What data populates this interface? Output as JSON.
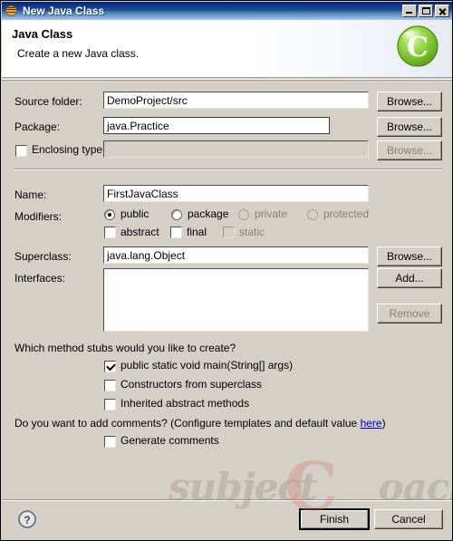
{
  "window": {
    "title": "New Java Class",
    "icon": "java-wizard-icon",
    "controls": {
      "minimize": "Minimize",
      "maximize": "Maximize",
      "close": "Close"
    }
  },
  "header": {
    "title": "Java Class",
    "subtitle": "Create a new Java class.",
    "icon": "green-c-class-icon"
  },
  "form": {
    "source_folder": {
      "label": "Source folder:",
      "value": "DemoProject/src",
      "browse": "Browse..."
    },
    "package": {
      "label": "Package:",
      "value": "java.Practice",
      "browse": "Browse..."
    },
    "enclosing_type": {
      "label": "Enclosing type:",
      "value": "",
      "checked": false,
      "browse": "Browse..."
    },
    "name": {
      "label": "Name:",
      "value": "FirstJavaClass"
    },
    "modifiers": {
      "label": "Modifiers:",
      "radios": [
        {
          "label": "public",
          "checked": true,
          "enabled": true
        },
        {
          "label": "package",
          "checked": false,
          "enabled": true
        },
        {
          "label": "private",
          "checked": false,
          "enabled": false
        },
        {
          "label": "protected",
          "checked": false,
          "enabled": false
        }
      ],
      "checkboxes": [
        {
          "label": "abstract",
          "checked": false,
          "enabled": true
        },
        {
          "label": "final",
          "checked": false,
          "enabled": true
        },
        {
          "label": "static",
          "checked": false,
          "enabled": false
        }
      ]
    },
    "superclass": {
      "label": "Superclass:",
      "value": "java.lang.Object",
      "browse": "Browse..."
    },
    "interfaces": {
      "label": "Interfaces:",
      "items": [],
      "add": "Add...",
      "remove": "Remove"
    }
  },
  "stubs": {
    "question": "Which method stubs would you like to create?",
    "options": [
      {
        "label": "public static void main(String[] args)",
        "checked": true
      },
      {
        "label": "Constructors from superclass",
        "checked": false
      },
      {
        "label": "Inherited abstract methods",
        "checked": false
      }
    ]
  },
  "comments": {
    "prefix": "Do you want to add comments? (Configure templates and default value ",
    "link": "here",
    "suffix": ")",
    "checkbox": {
      "label": "Generate comments",
      "checked": false
    }
  },
  "footer": {
    "help": "?",
    "finish": "Finish",
    "cancel": "Cancel"
  },
  "watermark": {
    "text": "subject",
    "accent": "C",
    "tail": "oach"
  }
}
